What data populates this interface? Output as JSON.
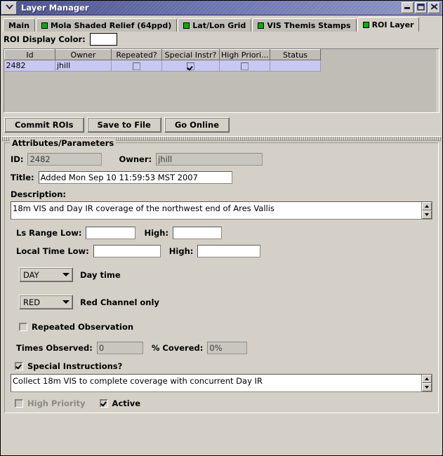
{
  "window": {
    "title": "Layer Manager",
    "menu_icon": "chevron-down-icon",
    "controls": {
      "minimize": "minimize-icon",
      "maximize": "maximize-icon",
      "close": "close-icon"
    }
  },
  "tabs": [
    {
      "label": "Main",
      "has_indicator": false,
      "active": false
    },
    {
      "label": "Mola Shaded Relief (64ppd)",
      "has_indicator": true,
      "active": false
    },
    {
      "label": "Lat/Lon Grid",
      "has_indicator": true,
      "active": false
    },
    {
      "label": "VIS Themis Stamps",
      "has_indicator": true,
      "active": false
    },
    {
      "label": "ROI Layer",
      "has_indicator": true,
      "active": true
    }
  ],
  "roi_display_color": {
    "label": "ROI Display Color:",
    "value": "#ffffff"
  },
  "table": {
    "columns": [
      "Id",
      "Owner",
      "Repeated?",
      "Special Instr?",
      "High Priori...",
      "Status"
    ],
    "rows": [
      {
        "id": "2482",
        "owner": "jhill",
        "repeated": false,
        "special_instr": true,
        "high_priority": false,
        "status": "",
        "selected": true
      }
    ],
    "selection_color": "#c8c8f0"
  },
  "actions": {
    "commit": "Commit ROIs",
    "save": "Save to File",
    "online": "Go Online"
  },
  "attributes": {
    "group_title": "Attributes/Parameters",
    "id_label": "ID:",
    "id_value": "2482",
    "owner_label": "Owner:",
    "owner_value": "jhill",
    "title_label": "Title:",
    "title_value": "Added Mon Sep 10 11:59:53 MST 2007",
    "description_label": "Description:",
    "description_value": "18m VIS and Day IR coverage of the northwest end of Ares Vallis",
    "ls_range_low_label": "Ls Range Low:",
    "ls_range_low_value": "",
    "ls_range_high_label": "High:",
    "ls_range_high_value": "",
    "local_time_low_label": "Local Time Low:",
    "local_time_low_value": "",
    "local_time_high_label": "High:",
    "local_time_high_value": "",
    "time_of_day": {
      "value": "DAY",
      "note": "Day time"
    },
    "channel": {
      "value": "RED",
      "note": "Red Channel only"
    },
    "repeated_observation": {
      "label": "Repeated Observation",
      "checked": false
    },
    "times_observed_label": "Times Observed:",
    "times_observed_value": "0",
    "percent_covered_label": "% Covered:",
    "percent_covered_value": "0%",
    "special_instructions": {
      "label": "Special Instructions?",
      "checked": true,
      "text": "Collect 18m VIS to complete coverage with concurrent Day IR"
    },
    "high_priority": {
      "label": "High Priority",
      "checked": false,
      "enabled": false
    },
    "active": {
      "label": "Active",
      "checked": true,
      "enabled": true
    }
  }
}
